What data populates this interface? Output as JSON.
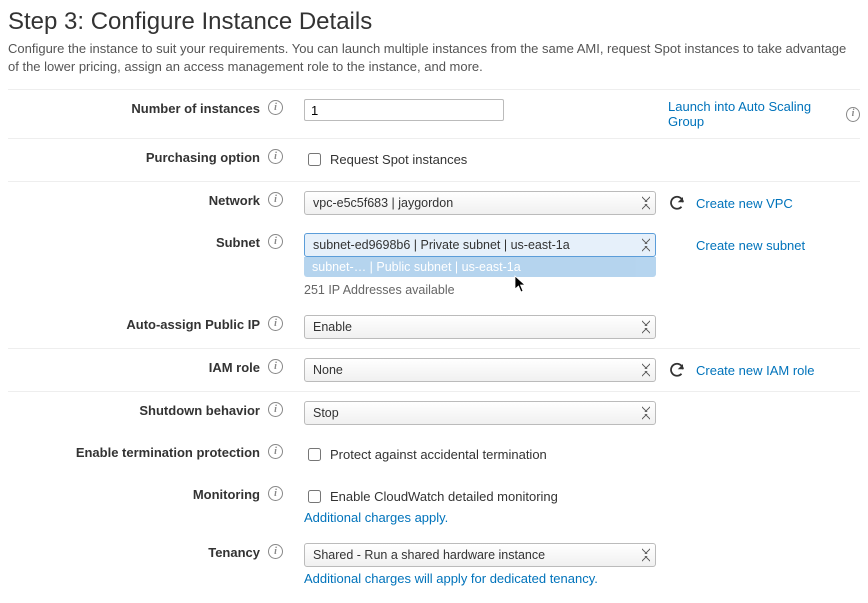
{
  "header": {
    "title": "Step 3: Configure Instance Details",
    "subtitle": "Configure the instance to suit your requirements. You can launch multiple instances from the same AMI, request Spot instances to take advantage of the lower pricing, assign an access management role to the instance, and more."
  },
  "rows": {
    "instances": {
      "label": "Number of instances",
      "value": "1",
      "launch_link": "Launch into Auto Scaling Group"
    },
    "purchasing": {
      "label": "Purchasing option",
      "checkbox": "Request Spot instances"
    },
    "network": {
      "label": "Network",
      "value": "vpc-e5c5f683 | jaygordon",
      "create_link": "Create new VPC"
    },
    "subnet": {
      "label": "Subnet",
      "value": "subnet-ed9698b6 | Private subnet | us-east-1a",
      "ghost_option": "subnet-… | Public subnet | us-east-1a",
      "help": "251 IP Addresses available",
      "create_link": "Create new subnet"
    },
    "public_ip": {
      "label": "Auto-assign Public IP",
      "value": "Enable"
    },
    "iam": {
      "label": "IAM role",
      "value": "None",
      "create_link": "Create new IAM role"
    },
    "shutdown": {
      "label": "Shutdown behavior",
      "value": "Stop"
    },
    "termination": {
      "label": "Enable termination protection",
      "checkbox": "Protect against accidental termination"
    },
    "monitoring": {
      "label": "Monitoring",
      "checkbox": "Enable CloudWatch detailed monitoring",
      "note": "Additional charges apply."
    },
    "tenancy": {
      "label": "Tenancy",
      "value": "Shared - Run a shared hardware instance",
      "note": "Additional charges will apply for dedicated tenancy."
    }
  }
}
